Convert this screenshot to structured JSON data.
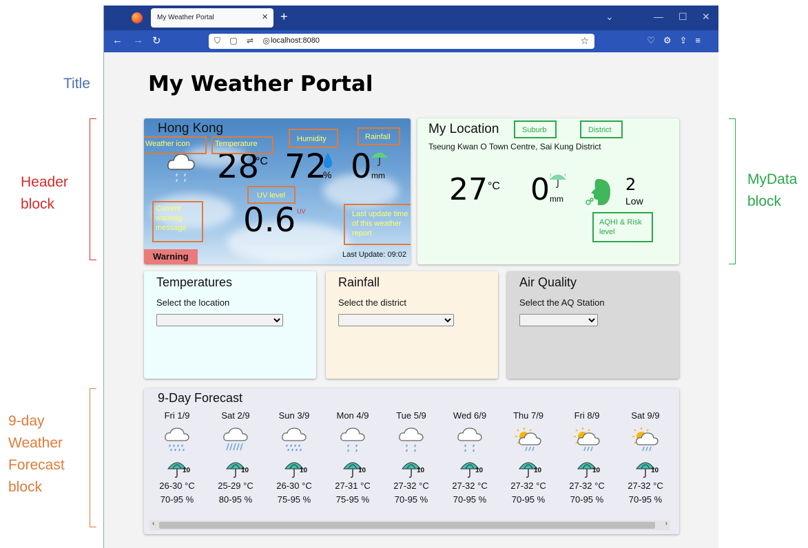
{
  "annotations": {
    "title": "Title",
    "header": [
      "Header",
      "block"
    ],
    "mydata": [
      "MyData",
      "block"
    ],
    "forecast": [
      "9-day",
      "Weather",
      "Forecast",
      "block"
    ]
  },
  "browser": {
    "tab_title": "My Weather Portal",
    "url": "localhost:8080"
  },
  "page": {
    "title": "My Weather Portal"
  },
  "header_block": {
    "city": "Hong Kong",
    "temperature": "28",
    "temp_unit": "°C",
    "humidity": "72",
    "humidity_unit": "%",
    "rainfall": "0",
    "rain_unit": "mm",
    "uv": "0.6",
    "uv_unit": "UV",
    "warning_label": "Warning",
    "last_update": "Last Update: 09:02",
    "labels": {
      "weather_icon": "Weather icon",
      "temperature": "Temperature",
      "humidity": "Humidity",
      "rainfall": "Rainfall",
      "uv_level": "UV level",
      "current_warning": "Current warning message",
      "last_update_note": "Last update time of this weather report"
    }
  },
  "my_location": {
    "title": "My Location",
    "suburb_label": "Suburb",
    "district_label": "District",
    "address": "Tseung Kwan O Town Centre, Sai Kung District",
    "temperature": "27",
    "temp_unit": "°C",
    "rainfall": "0",
    "rain_unit": "mm",
    "aqhi": "2",
    "risk": "Low",
    "aqhi_label": "AQHI & Risk level"
  },
  "panels": {
    "temperatures": {
      "title": "Temperatures",
      "label": "Select the location"
    },
    "rainfall": {
      "title": "Rainfall",
      "label": "Select the district"
    },
    "air_quality": {
      "title": "Air Quality",
      "label": "Select the AQ Station"
    }
  },
  "forecast": {
    "title": "9-Day Forecast",
    "days": [
      {
        "date": "Fri 1/9",
        "temp": "26-30 °C",
        "hum": "70-95 %",
        "icon": "rain-showers-icon"
      },
      {
        "date": "Sat 2/9",
        "temp": "25-29 °C",
        "hum": "80-95 %",
        "icon": "heavy-rain-icon"
      },
      {
        "date": "Sun 3/9",
        "temp": "26-30 °C",
        "hum": "75-95 %",
        "icon": "rain-showers-icon"
      },
      {
        "date": "Mon 4/9",
        "temp": "27-31 °C",
        "hum": "75-95 %",
        "icon": "light-rain-icon"
      },
      {
        "date": "Tue 5/9",
        "temp": "27-32 °C",
        "hum": "70-95 %",
        "icon": "light-rain-icon"
      },
      {
        "date": "Wed 6/9",
        "temp": "27-32 °C",
        "hum": "70-95 %",
        "icon": "light-rain-icon"
      },
      {
        "date": "Thu 7/9",
        "temp": "27-32 °C",
        "hum": "70-95 %",
        "icon": "sunny-showers-icon"
      },
      {
        "date": "Fri 8/9",
        "temp": "27-32 °C",
        "hum": "70-95 %",
        "icon": "sunny-showers-icon"
      },
      {
        "date": "Sat 9/9",
        "temp": "27-32 °C",
        "hum": "70-95 %",
        "icon": "sunny-showers-icon"
      }
    ],
    "umbrella_value": "10"
  },
  "colors": {
    "annotation_title": "#4a6fb5",
    "annotation_header": "#d42b2b",
    "annotation_mydata": "#2aa84a",
    "annotation_forecast": "#e07b39",
    "tab_bar": "#1e3f8f",
    "nav_bar": "#2b55b8",
    "temperatures_panel": "#eefdfd",
    "rainfall_panel": "#fdf3e3",
    "air_quality_panel": "#d9d9d9",
    "location_panel": "#eefdf0",
    "forecast_panel": "#eaebf3",
    "warning": "#e97b7b"
  }
}
